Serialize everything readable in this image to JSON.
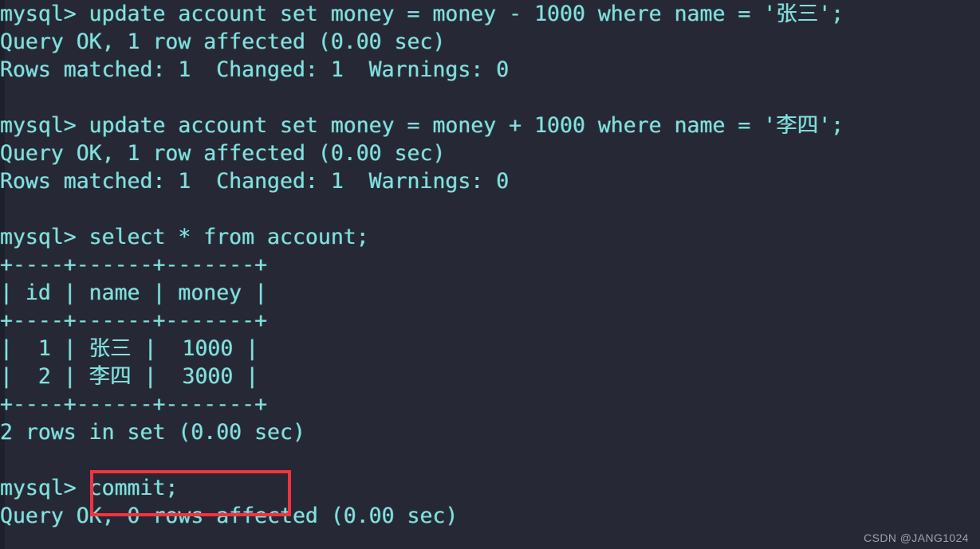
{
  "terminal": {
    "background_color": "#262935",
    "text_color": "#86dfdd",
    "highlight_color": "#f6323f",
    "prompt": "mysql>",
    "lines": [
      "mysql> update account set money = money - 1000 where name = '张三';",
      "Query OK, 1 row affected (0.00 sec)",
      "Rows matched: 1  Changed: 1  Warnings: 0",
      "",
      "mysql> update account set money = money + 1000 where name = '李四';",
      "Query OK, 1 row affected (0.00 sec)",
      "Rows matched: 1  Changed: 1  Warnings: 0",
      "",
      "mysql> select * from account;",
      "+----+------+-------+",
      "| id | name | money |",
      "+----+------+-------+",
      "|  1 | 张三 |  1000 |",
      "|  2 | 李四 |  3000 |",
      "+----+------+-------+",
      "2 rows in set (0.00 sec)",
      "",
      "mysql> commit;",
      "Query OK, 0 rows affected (0.00 sec)"
    ]
  },
  "statements": [
    {
      "command": "update account set money = money - 1000 where name = '张三';",
      "result_status": "Query OK, 1 row affected (0.00 sec)",
      "result_detail": "Rows matched: 1  Changed: 1  Warnings: 0"
    },
    {
      "command": "update account set money = money + 1000 where name = '李四';",
      "result_status": "Query OK, 1 row affected (0.00 sec)",
      "result_detail": "Rows matched: 1  Changed: 1  Warnings: 0"
    },
    {
      "command": "select * from account;",
      "result_status": "2 rows in set (0.00 sec)"
    },
    {
      "command": "commit;",
      "result_status": "Query OK, 0 rows affected (0.00 sec)"
    }
  ],
  "result_table": {
    "separator": "+----+------+-------+",
    "headers": [
      "id",
      "name",
      "money"
    ],
    "header_row": "| id | name | money |",
    "rows": [
      {
        "raw": "|  1 | 张三 |  1000 |",
        "id": "1",
        "name": "张三",
        "money": "1000"
      },
      {
        "raw": "|  2 | 李四 |  3000 |",
        "id": "2",
        "name": "李四",
        "money": "3000"
      }
    ],
    "row_count_text": "2 rows in set (0.00 sec)"
  },
  "highlight": {
    "target_text": "commit;",
    "color": "#f6323f"
  },
  "watermark": {
    "text": "CSDN @JANG1024"
  }
}
